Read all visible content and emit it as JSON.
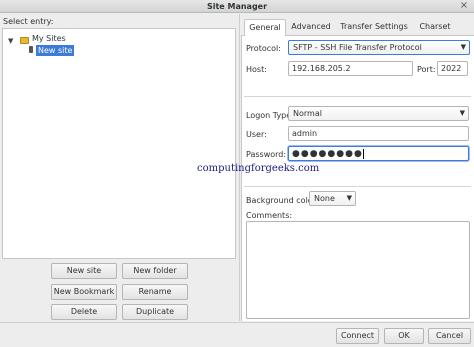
{
  "window": {
    "title": "Site Manager",
    "close_icon": "×"
  },
  "left": {
    "select_label": "Select entry:",
    "tree": {
      "folder": "My Sites",
      "expander": "▼",
      "selected_site": "New site"
    },
    "buttons": {
      "new_site": "New site",
      "new_folder": "New folder",
      "new_bookmark": "New Bookmark",
      "rename": "Rename",
      "delete": "Delete",
      "duplicate": "Duplicate"
    }
  },
  "tabs": [
    "General",
    "Advanced",
    "Transfer Settings",
    "Charset"
  ],
  "general": {
    "protocol_label": "Protocol:",
    "protocol_value": "SFTP - SSH File Transfer Protocol",
    "host_label": "Host:",
    "host_value": "192.168.205.2",
    "port_label": "Port:",
    "port_value": "2022",
    "logon_type_label": "Logon Type:",
    "logon_type_value": "Normal",
    "user_label": "User:",
    "user_value": "admin",
    "password_label": "Password:",
    "password_value": "●●●●●●●●",
    "bg_color_label": "Background color:",
    "bg_color_value": "None",
    "comments_label": "Comments:"
  },
  "watermark": "computingforgeeks.com",
  "footer": {
    "connect": "Connect",
    "ok": "OK",
    "cancel": "Cancel"
  },
  "icons": {
    "dropdown": "▼"
  },
  "colors": {
    "selection": "#3d7bd8",
    "folder": "#e7b93a"
  }
}
